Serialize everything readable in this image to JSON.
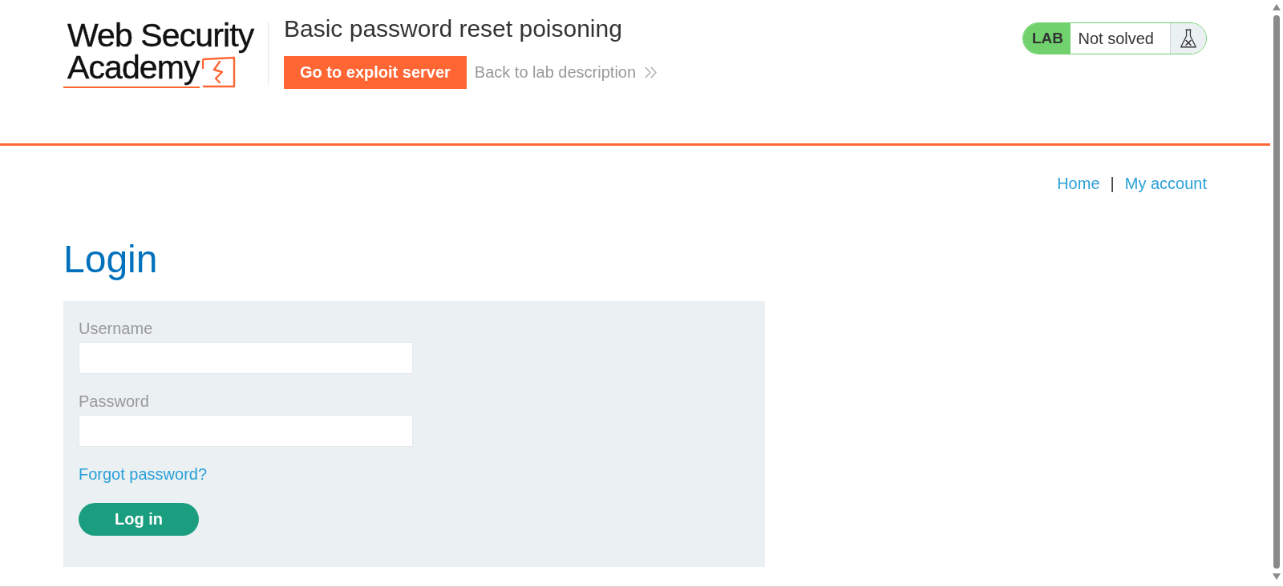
{
  "header": {
    "logo": {
      "line_1": "Web Security",
      "line_2": "Academy"
    },
    "lab_title": "Basic password reset poisoning",
    "exploit_button": "Go to exploit server",
    "back_link": "Back to lab description",
    "lab_status": {
      "tag": "LAB",
      "status": "Not solved",
      "solved": false
    }
  },
  "nav": {
    "links": [
      {
        "label": "Home"
      },
      {
        "label": "My account"
      }
    ],
    "separator": "|"
  },
  "login": {
    "heading": "Login",
    "fields": [
      {
        "label": "Username"
      },
      {
        "label": "Password"
      }
    ],
    "forgot_link": "Forgot password?",
    "submit_button": "Log in"
  }
}
